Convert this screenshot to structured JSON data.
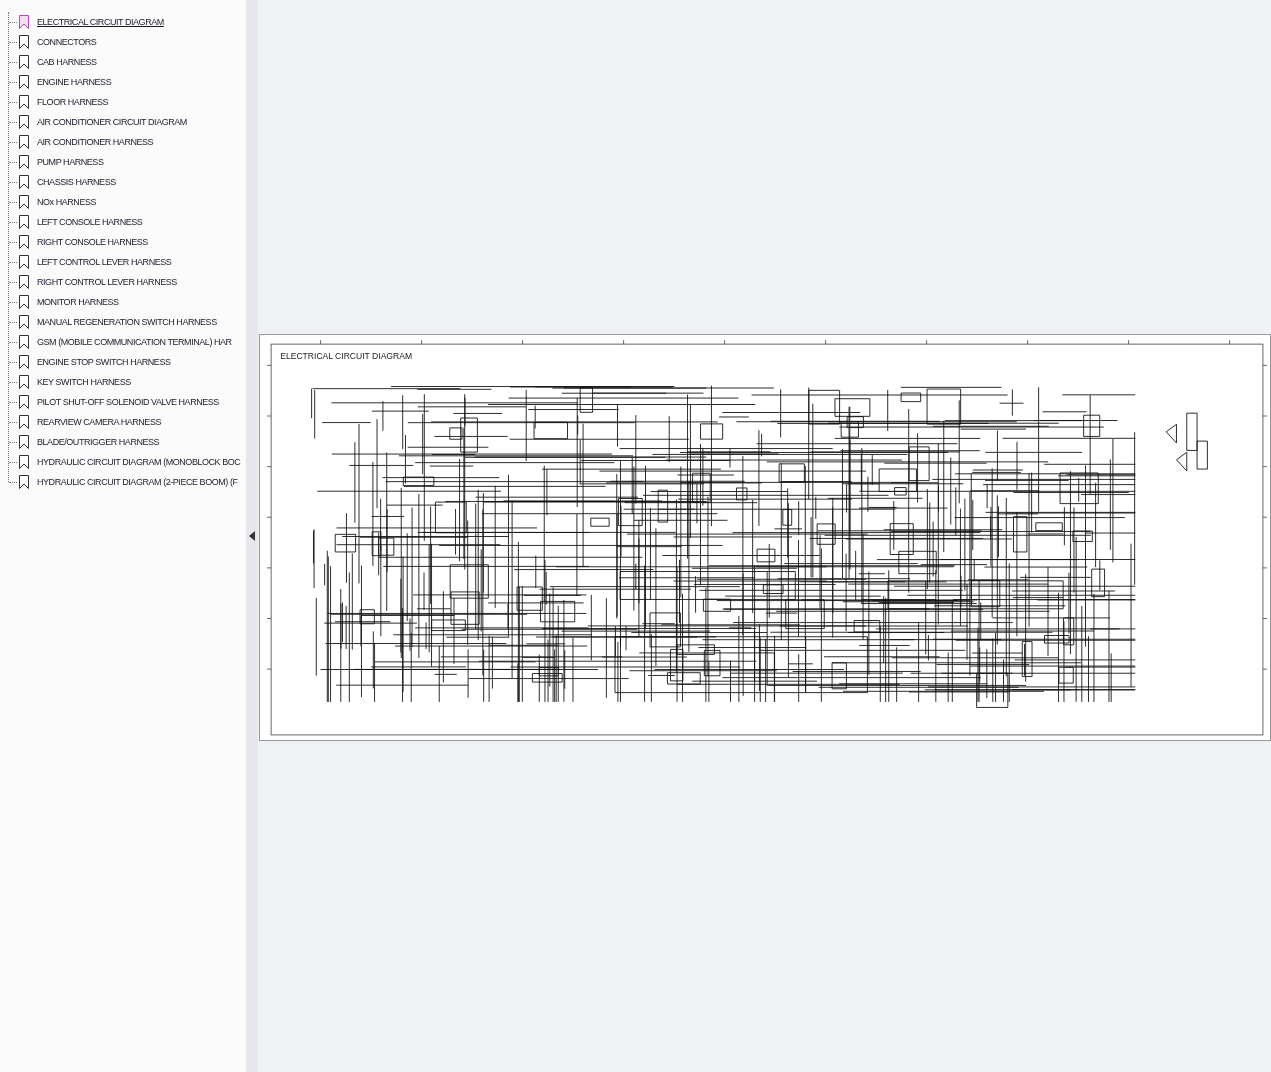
{
  "sidebar": {
    "bookmarks": [
      {
        "label": "ELECTRICAL CIRCUIT DIAGRAM",
        "selected": true
      },
      {
        "label": "CONNECTORS",
        "selected": false
      },
      {
        "label": "CAB HARNESS",
        "selected": false
      },
      {
        "label": "ENGINE HARNESS",
        "selected": false
      },
      {
        "label": "FLOOR HARNESS",
        "selected": false
      },
      {
        "label": "AIR CONDITIONER CIRCUIT DIAGRAM",
        "selected": false
      },
      {
        "label": "AIR CONDITIONER HARNESS",
        "selected": false
      },
      {
        "label": "PUMP HARNESS",
        "selected": false
      },
      {
        "label": "CHASSIS HARNESS",
        "selected": false
      },
      {
        "label": "NOx HARNESS",
        "selected": false
      },
      {
        "label": "LEFT CONSOLE HARNESS",
        "selected": false
      },
      {
        "label": "RIGHT CONSOLE HARNESS",
        "selected": false
      },
      {
        "label": "LEFT CONTROL LEVER HARNESS",
        "selected": false
      },
      {
        "label": "RIGHT CONTROL LEVER HARNESS",
        "selected": false
      },
      {
        "label": "MONITOR HARNESS",
        "selected": false
      },
      {
        "label": "MANUAL REGENERATION SWITCH HARNESS",
        "selected": false
      },
      {
        "label": "GSM (MOBILE COMMUNICATION TERMINAL) HAR",
        "selected": false
      },
      {
        "label": "ENGINE STOP SWITCH HARNESS",
        "selected": false
      },
      {
        "label": "KEY SWITCH HARNESS",
        "selected": false
      },
      {
        "label": "PILOT SHUT-OFF SOLENOID VALVE HARNESS",
        "selected": false
      },
      {
        "label": "REARVIEW CAMERA HARNESS",
        "selected": false
      },
      {
        "label": "BLADE/OUTRIGGER HARNESS",
        "selected": false
      },
      {
        "label": "HYDRAULIC CIRCUIT DIAGRAM (MONOBLOCK BOC",
        "selected": false
      },
      {
        "label": "HYDRAULIC CIRCUIT DIAGRAM (2-PIECE BOOM) (F",
        "selected": false
      }
    ]
  },
  "document": {
    "title": "ELECTRICAL CIRCUIT DIAGRAM"
  }
}
